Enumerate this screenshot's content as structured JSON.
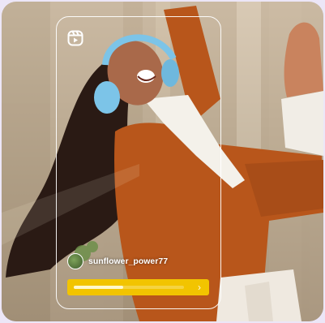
{
  "reel": {
    "icon": "reels-icon",
    "username": "sunflower_power77",
    "avatar": "avatar-image",
    "cta": {
      "icon": "chevron-right-icon",
      "chevron_glyph": "›",
      "progress": 0.45
    }
  },
  "colors": {
    "cta_background": "#f2c400",
    "frame_border": "#ffffff",
    "jacket": "#b8561b",
    "headphones": "#7cc4e8"
  }
}
